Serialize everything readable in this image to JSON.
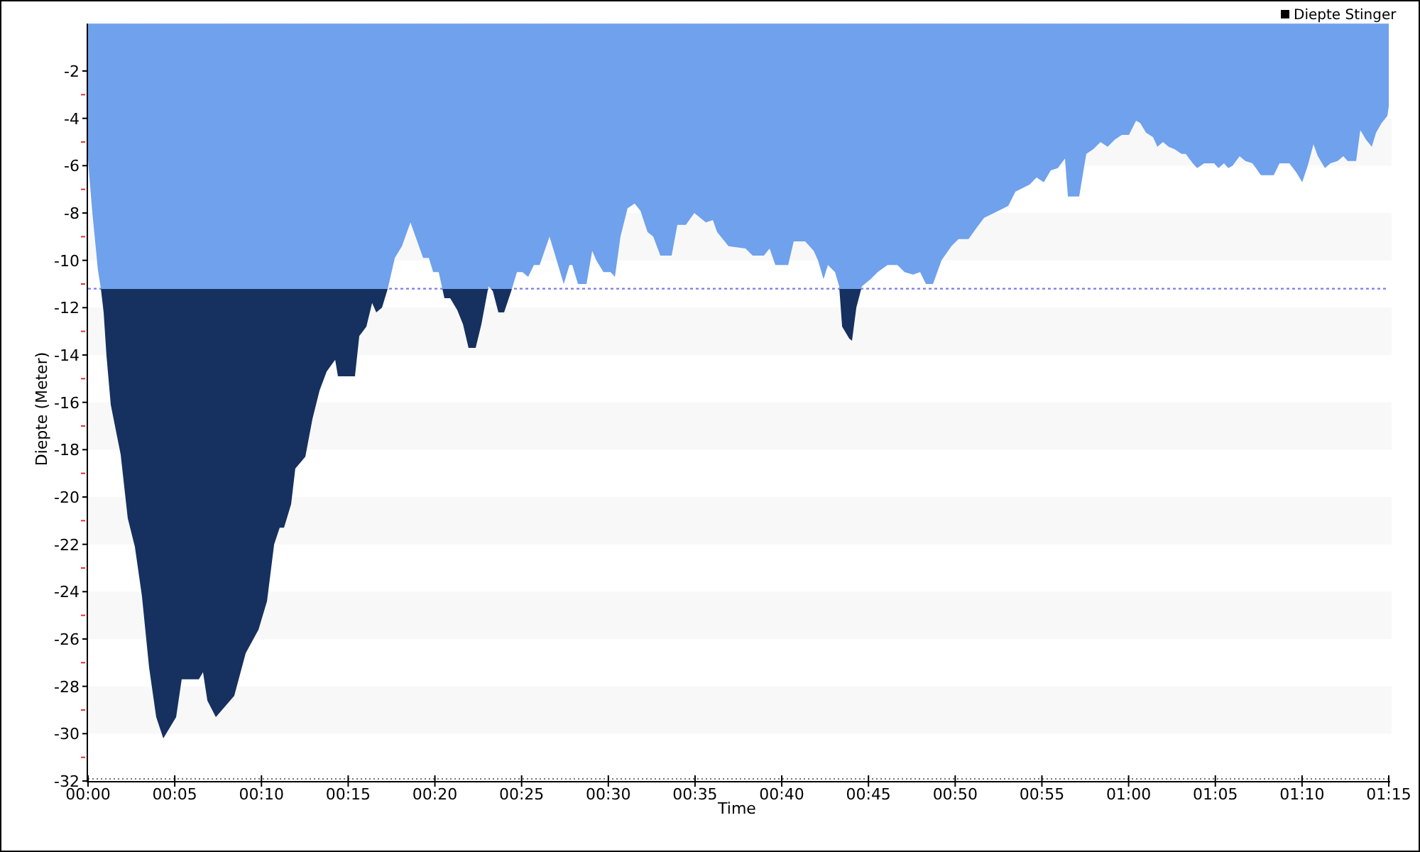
{
  "chart": {
    "chart_data": {
      "type": "area",
      "xlabel": "Time",
      "ylabel": "Diepte (Meter)",
      "x": [
        0,
        0.08,
        0.25,
        0.41,
        0.57,
        0.74,
        0.9,
        1.06,
        1.31,
        1.88,
        2.29,
        2.7,
        3.11,
        3.52,
        3.93,
        4.34,
        5.08,
        5.4,
        6.39,
        6.63,
        6.88,
        7.37,
        8.43,
        9.09,
        9.83,
        10.32,
        10.73,
        11.05,
        11.3,
        11.71,
        11.95,
        12.53,
        12.94,
        13.35,
        13.76,
        14.25,
        14.41,
        15.39,
        15.64,
        16.05,
        16.38,
        16.62,
        16.95,
        17.28,
        17.69,
        18.1,
        18.59,
        19.08,
        19.32,
        19.65,
        19.9,
        20.22,
        20.55,
        20.88,
        21.29,
        21.62,
        21.94,
        22.35,
        22.68,
        23.09,
        23.34,
        23.66,
        23.99,
        24.4,
        24.73,
        25.05,
        25.38,
        25.71,
        26.04,
        26.61,
        26.94,
        27.43,
        27.76,
        27.92,
        28.25,
        28.74,
        29.07,
        29.31,
        29.72,
        30.13,
        30.38,
        30.7,
        31.11,
        31.52,
        31.85,
        32.26,
        32.59,
        33,
        33.65,
        33.98,
        34.47,
        34.96,
        35.62,
        36.03,
        36.27,
        36.93,
        37.91,
        38.32,
        38.97,
        39.3,
        39.63,
        40.37,
        40.69,
        41.35,
        41.84,
        42.09,
        42.41,
        42.66,
        43.07,
        43.31,
        43.48,
        43.89,
        44.05,
        44.3,
        44.62,
        45.12,
        45.53,
        46.1,
        46.67,
        47.08,
        47.57,
        47.98,
        48.31,
        48.72,
        49.21,
        49.78,
        50.19,
        50.77,
        51.26,
        51.67,
        52.24,
        53.06,
        53.47,
        54.29,
        54.69,
        55.11,
        55.51,
        55.92,
        56.33,
        56.5,
        57.15,
        57.56,
        57.97,
        58.38,
        58.79,
        59.2,
        59.61,
        60.02,
        60.43,
        60.67,
        61,
        61.41,
        61.66,
        61.98,
        62.31,
        62.64,
        63.05,
        63.29,
        63.7,
        63.95,
        64.36,
        64.93,
        65.18,
        65.5,
        65.75,
        66,
        66.4,
        66.73,
        67.14,
        67.63,
        68.37,
        68.7,
        69.27,
        69.68,
        70.01,
        70.33,
        70.66,
        70.91,
        71.32,
        71.64,
        72.05,
        72.38,
        72.63,
        73.12,
        73.36,
        73.69,
        74.02,
        74.27,
        74.59,
        74.92,
        75
      ],
      "series": [
        {
          "name": "Diepte Stinger",
          "color": "#6fa1ec",
          "values": [
            -5.7,
            -6.5,
            -8,
            -9.2,
            -10.4,
            -11.2,
            -12.2,
            -14,
            -16.1,
            -18.2,
            -20.9,
            -22.1,
            -24.2,
            -27.2,
            -29.3,
            -30.2,
            -29.3,
            -27.7,
            -27.7,
            -27.4,
            -28.6,
            -29.3,
            -28.4,
            -26.6,
            -25.6,
            -24.4,
            -22,
            -21.3,
            -21.3,
            -20.3,
            -18.8,
            -18.3,
            -16.7,
            -15.5,
            -14.7,
            -14.2,
            -14.9,
            -14.9,
            -13.2,
            -12.8,
            -11.8,
            -12.2,
            -12,
            -11.2,
            -9.9,
            -9.4,
            -8.4,
            -9.4,
            -9.9,
            -9.9,
            -10.5,
            -10.5,
            -11.6,
            -11.6,
            -12.1,
            -12.7,
            -13.7,
            -13.7,
            -12.7,
            -11.1,
            -11.3,
            -12.2,
            -12.2,
            -11.3,
            -10.5,
            -10.5,
            -10.7,
            -10.2,
            -10.2,
            -9,
            -9.8,
            -11,
            -10.2,
            -10.2,
            -11,
            -11,
            -9.6,
            -10,
            -10.5,
            -10.5,
            -10.7,
            -9,
            -7.8,
            -7.6,
            -7.9,
            -8.8,
            -9,
            -9.8,
            -9.8,
            -8.5,
            -8.5,
            -8,
            -8.4,
            -8.3,
            -8.8,
            -9.4,
            -9.5,
            -9.8,
            -9.8,
            -9.5,
            -10.2,
            -10.2,
            -9.2,
            -9.2,
            -9.6,
            -10,
            -10.8,
            -10.2,
            -10.5,
            -11.1,
            -12.8,
            -13.3,
            -13.4,
            -12,
            -11.1,
            -10.8,
            -10.5,
            -10.2,
            -10.2,
            -10.5,
            -10.6,
            -10.5,
            -11,
            -11,
            -10,
            -9.4,
            -9.1,
            -9.1,
            -8.6,
            -8.2,
            -8,
            -7.7,
            -7.1,
            -6.8,
            -6.5,
            -6.7,
            -6.2,
            -6.1,
            -5.7,
            -7.3,
            -7.3,
            -5.5,
            -5.3,
            -5,
            -5.2,
            -4.9,
            -4.7,
            -4.7,
            -4.1,
            -4.2,
            -4.6,
            -4.8,
            -5.2,
            -5,
            -5.2,
            -5.3,
            -5.5,
            -5.5,
            -5.9,
            -6.1,
            -5.9,
            -5.9,
            -6.1,
            -5.9,
            -6.1,
            -6,
            -5.6,
            -5.8,
            -5.9,
            -6.4,
            -6.4,
            -5.9,
            -5.9,
            -6.3,
            -6.7,
            -6,
            -5.1,
            -5.6,
            -6.1,
            -5.9,
            -5.8,
            -5.6,
            -5.8,
            -5.8,
            -4.5,
            -4.9,
            -5.2,
            -4.6,
            -4.2,
            -3.9,
            -3.5
          ]
        }
      ],
      "xlim": [
        0,
        75
      ],
      "ylim": [
        -32,
        0
      ],
      "xticks": [
        {
          "value": 0,
          "label": "00:00"
        },
        {
          "value": 5,
          "label": "00:05"
        },
        {
          "value": 10,
          "label": "00:10"
        },
        {
          "value": 15,
          "label": "00:15"
        },
        {
          "value": 20,
          "label": "00:20"
        },
        {
          "value": 25,
          "label": "00:25"
        },
        {
          "value": 30,
          "label": "00:30"
        },
        {
          "value": 35,
          "label": "00:35"
        },
        {
          "value": 40,
          "label": "00:40"
        },
        {
          "value": 45,
          "label": "00:45"
        },
        {
          "value": 50,
          "label": "00:50"
        },
        {
          "value": 55,
          "label": "00:55"
        },
        {
          "value": 60,
          "label": "01:00"
        },
        {
          "value": 65,
          "label": "01:05"
        },
        {
          "value": 70,
          "label": "01:10"
        },
        {
          "value": 75,
          "label": "01:15"
        }
      ],
      "yticks": [
        -2,
        -4,
        -6,
        -8,
        -10,
        -12,
        -14,
        -16,
        -18,
        -20,
        -22,
        -24,
        -26,
        -28,
        -30,
        -32
      ],
      "ref_lines": [
        {
          "axis": "y",
          "value": -11.2,
          "color": "#7b7bea"
        }
      ]
    }
  }
}
